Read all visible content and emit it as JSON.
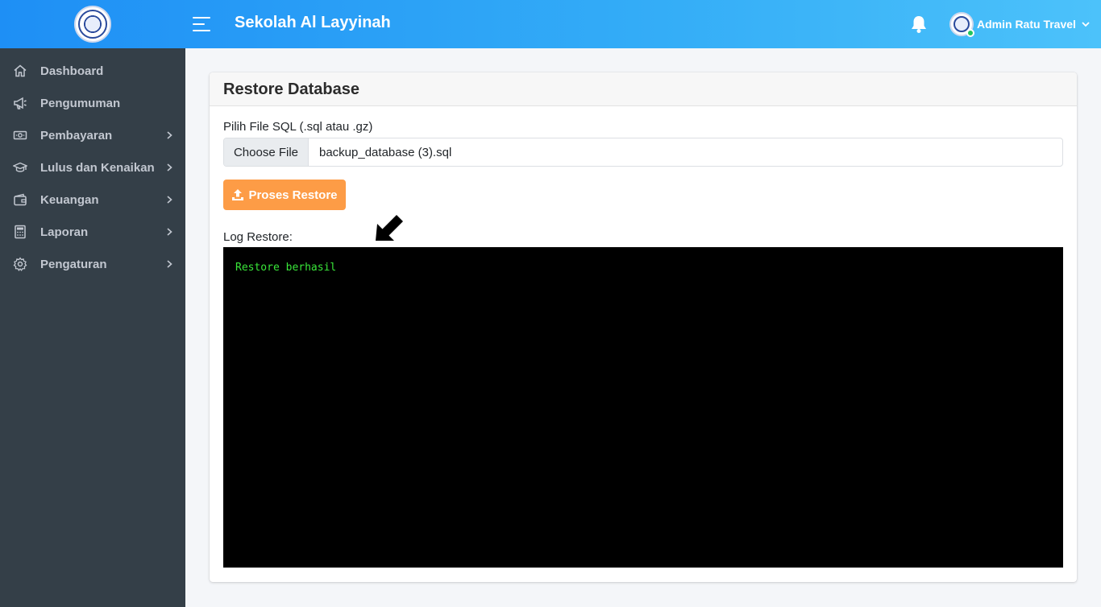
{
  "header": {
    "app_title": "Sekolah Al Layyinah",
    "user_name": "Admin Ratu Travel",
    "logo": "school-logo",
    "menu_icon": "hamburger-icon",
    "notification_icon": "bell-icon",
    "status": "online",
    "colors": {
      "gradient_start": "#1e8ff5",
      "gradient_end": "#4cc2fa"
    }
  },
  "sidebar": {
    "background": "#343f48",
    "items": [
      {
        "label": "Dashboard",
        "icon": "home-icon",
        "has_submenu": false
      },
      {
        "label": "Pengumuman",
        "icon": "megaphone-icon",
        "has_submenu": false
      },
      {
        "label": "Pembayaran",
        "icon": "money-icon",
        "has_submenu": true
      },
      {
        "label": "Lulus dan Kenaikan",
        "icon": "graduation-cap-icon",
        "has_submenu": true
      },
      {
        "label": "Keuangan",
        "icon": "wallet-icon",
        "has_submenu": true
      },
      {
        "label": "Laporan",
        "icon": "calculator-icon",
        "has_submenu": true
      },
      {
        "label": "Pengaturan",
        "icon": "gear-icon",
        "has_submenu": true
      }
    ]
  },
  "main": {
    "card_title": "Restore Database",
    "file_label": "Pilih File SQL (.sql atau .gz)",
    "choose_file_label": "Choose File",
    "selected_file": "backup_database (3).sql",
    "restore_button_label": "Proses Restore",
    "restore_button_color": "#fd9c46",
    "log_label": "Log Restore:",
    "log_text": "Restore berhasil",
    "log_text_color": "#39e639"
  }
}
